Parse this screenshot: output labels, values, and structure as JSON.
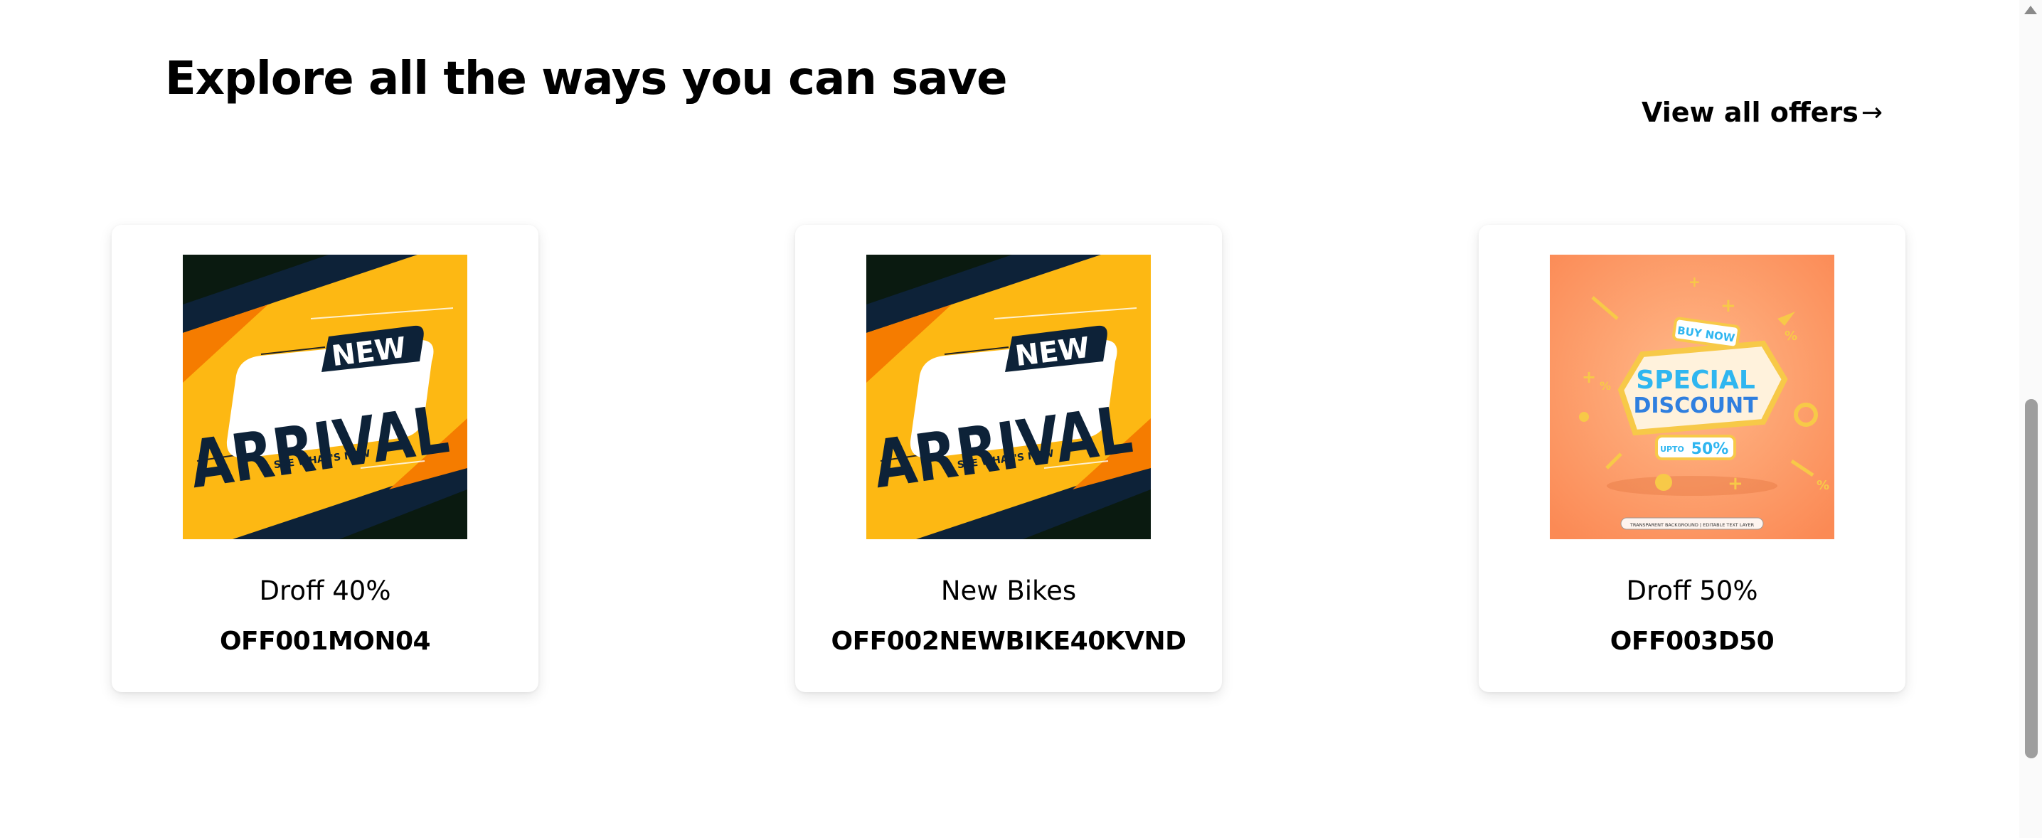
{
  "section": {
    "title": "Explore all the ways you can save",
    "view_all_label": "View all offers",
    "view_all_arrow": "→"
  },
  "offers": [
    {
      "name": "Droff 40%",
      "code": "OFF001MON04",
      "image": {
        "kind": "new-arrival-banner",
        "badge": "NEW",
        "headline": "ARRIVAL",
        "tagline": "SEE WHAT'S NEW",
        "colors": {
          "bg": "#FDB813",
          "dark": "#0D2238",
          "accent": "#F57C00"
        }
      }
    },
    {
      "name": "New Bikes",
      "code": "OFF002NEWBIKE40KVND",
      "image": {
        "kind": "new-arrival-banner",
        "badge": "NEW",
        "headline": "ARRIVAL",
        "tagline": "SEE WHAT'S NEW",
        "colors": {
          "bg": "#FDB813",
          "dark": "#0D2238",
          "accent": "#F57C00"
        }
      }
    },
    {
      "name": "Droff 50%",
      "code": "OFF003D50",
      "image": {
        "kind": "special-discount-banner",
        "tag": "BUY NOW",
        "line1": "SPECIAL",
        "line2": "DISCOUNT",
        "upto": "UPTO",
        "percent": "50%",
        "footer": "TRANSPARENT BACKGROUND | EDITABLE TEXT LAYER",
        "colors": {
          "bg": "#FB9A66",
          "text": "#2FB6F0",
          "gold": "#F7C948"
        }
      }
    }
  ]
}
